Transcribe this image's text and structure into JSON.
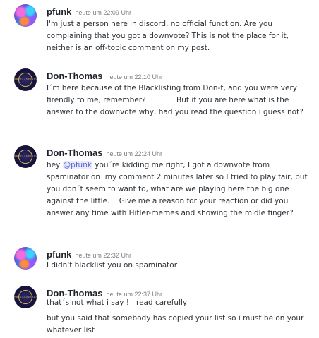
{
  "messages": [
    {
      "username": "pfunk",
      "timestamp": "heute um 22:09 Uhr",
      "text": "I'm just a person here in discord, no official function. Are you complaining that you got a downvote? This is not the place for it, neither is an off-topic comment on my post."
    },
    {
      "username": "Don-Thomas",
      "timestamp": "heute um 22:10 Uhr",
      "avatar_text": "BRUTAANIMALS",
      "text": "I´m here because of the Blacklisting from Don-t, and you were very firendly to me, remember?             But if you are here what is the answer to the downvote why, had you read the question i guess not?"
    },
    {
      "username": "Don-Thomas",
      "timestamp": "heute um 22:24 Uhr",
      "avatar_text": "BRUTAANIMALS",
      "text_before": "hey ",
      "mention": "@pfunk",
      "text_after": " you´re kidding me right, I got a downvote from spaminator on  my comment 2 minutes later so I tried to play fair, but you don´t seem to want to, what are we playing here the big one against the little.    Give me a reason for your reaction or did you answer any time with Hitler-memes and showing the midle finger?"
    },
    {
      "username": "pfunk",
      "timestamp": "heute um 22:32 Uhr",
      "text": "I didn't blacklist you on spaminator"
    },
    {
      "username": "Don-Thomas",
      "timestamp": "heute um 22:37 Uhr",
      "avatar_text": "BRUTAANIMALS",
      "text": "that´s not what i say !   read carefully",
      "text_2": "but you said that somebody has copied your list so i must be on your whatever list"
    }
  ]
}
